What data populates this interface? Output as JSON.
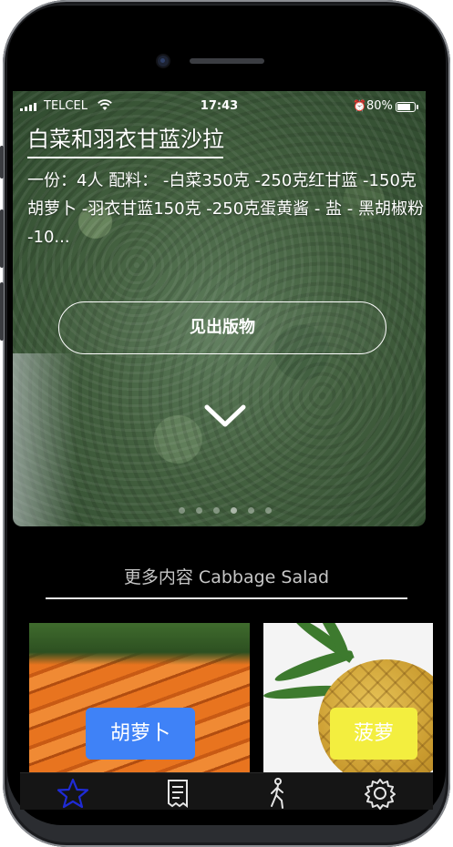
{
  "status_bar": {
    "carrier": "TELCEL",
    "time": "17:43",
    "battery": "80%"
  },
  "hero": {
    "title": "白菜和羽衣甘蓝沙拉",
    "description": "一份：4人  配料：  -白菜350克 -250克红甘蓝 -150克胡萝卜 -羽衣甘蓝150克 -250克蛋黄酱 - 盐 - 黑胡椒粉 -10...",
    "cta_label": "见出版物",
    "carousel_dots": 6,
    "active_dot": 3
  },
  "more_section": {
    "title": "更多内容 Cabbage Salad"
  },
  "cards": [
    {
      "label": "胡萝卜",
      "chip_color": "#3f82f7"
    },
    {
      "label": "菠萝",
      "chip_color": "#f3ee3f"
    }
  ],
  "tab_bar": {
    "items": [
      {
        "icon": "star-icon",
        "active": true
      },
      {
        "icon": "list-icon",
        "active": false
      },
      {
        "icon": "walking-person-icon",
        "active": false
      },
      {
        "icon": "gear-icon",
        "active": false
      }
    ],
    "active_color": "#1f2bd6"
  }
}
